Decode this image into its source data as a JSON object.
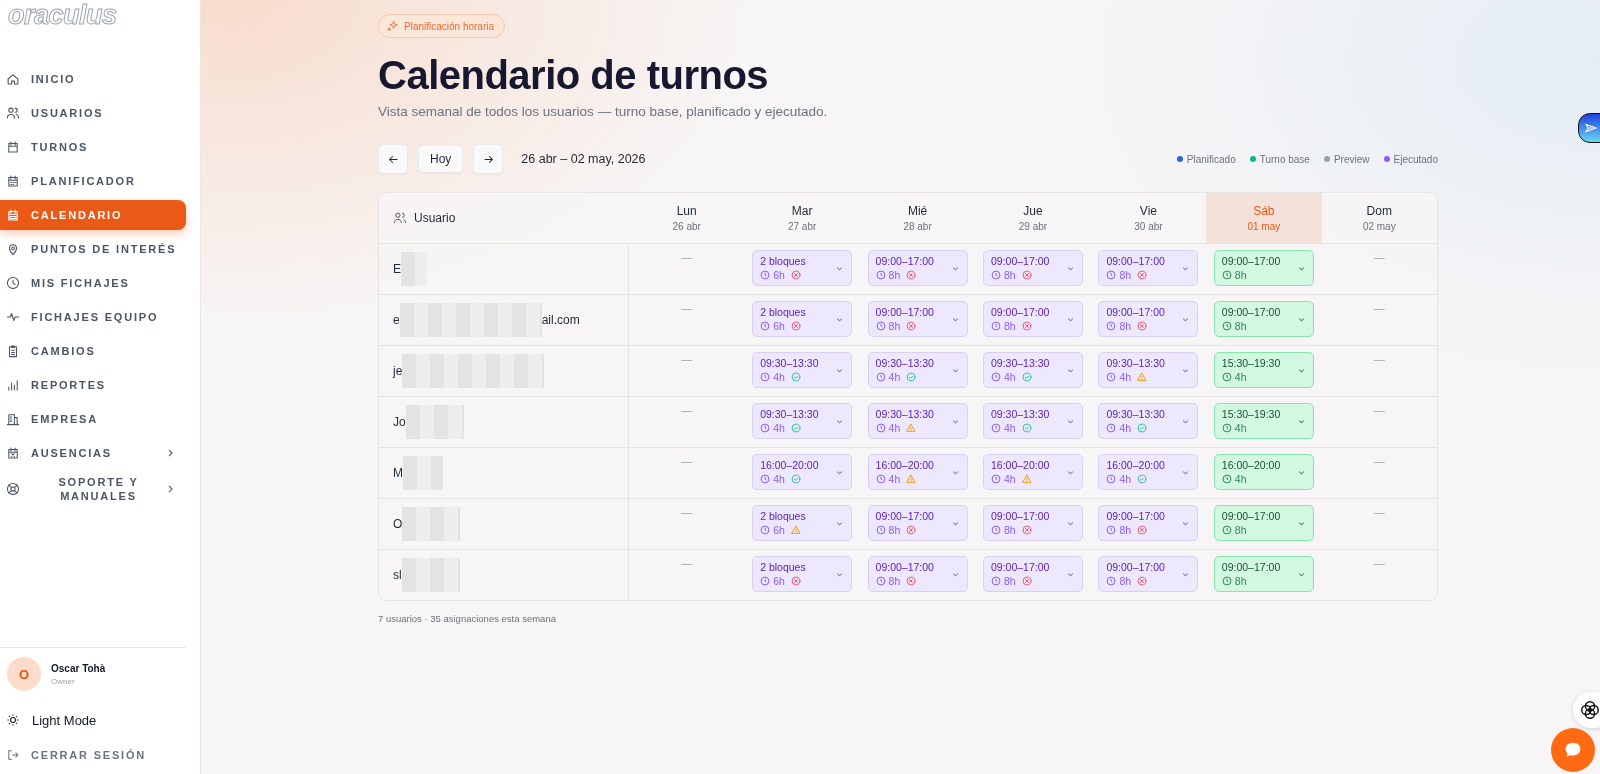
{
  "sidebar": {
    "logo": "oraculus",
    "items": [
      {
        "label": "INICIO",
        "selected": false,
        "submenu": false
      },
      {
        "label": "USUARIOS",
        "selected": false,
        "submenu": false
      },
      {
        "label": "TURNOS",
        "selected": false,
        "submenu": false
      },
      {
        "label": "PLANIFICADOR",
        "selected": false,
        "submenu": false
      },
      {
        "label": "CALENDARIO",
        "selected": true,
        "submenu": false
      },
      {
        "label": "PUNTOS DE INTERÉS",
        "selected": false,
        "submenu": false
      },
      {
        "label": "MIS FICHAJES",
        "selected": false,
        "submenu": false
      },
      {
        "label": "FICHAJES EQUIPO",
        "selected": false,
        "submenu": false
      },
      {
        "label": "CAMBIOS",
        "selected": false,
        "submenu": false
      },
      {
        "label": "REPORTES",
        "selected": false,
        "submenu": false
      },
      {
        "label": "EMPRESA",
        "selected": false,
        "submenu": false
      },
      {
        "label": "AUSENCIAS",
        "selected": false,
        "submenu": true
      },
      {
        "label": "SOPORTE Y MANUALES",
        "selected": false,
        "submenu": true
      }
    ],
    "user": {
      "initial": "O",
      "name": "Oscar Tohà",
      "role": "Owner"
    },
    "theme": "Light Mode",
    "logout": "CERRAR SESIÓN"
  },
  "header": {
    "badge": "Planificación horaria",
    "title": "Calendario de turnos",
    "subtitle": "Vista semanal de todos los usuarios — turno base, planificado y ejecutado."
  },
  "toolbar": {
    "today": "Hoy",
    "range": "26 abr – 02 may, 2026"
  },
  "legend": [
    {
      "label": "Planificado",
      "color": "#2563eb"
    },
    {
      "label": "Turno base",
      "color": "#10b981"
    },
    {
      "label": "Preview",
      "color": "#94a3b8"
    },
    {
      "label": "Ejecutado",
      "color": "#8b5cf6"
    }
  ],
  "table": {
    "user_column": "Usuario",
    "days": [
      {
        "name": "Lun",
        "date": "26 abr",
        "selected": false
      },
      {
        "name": "Mar",
        "date": "27 abr",
        "selected": false
      },
      {
        "name": "Mié",
        "date": "28 abr",
        "selected": false
      },
      {
        "name": "Jue",
        "date": "29 abr",
        "selected": false
      },
      {
        "name": "Vie",
        "date": "30 abr",
        "selected": false
      },
      {
        "name": "Sáb",
        "date": "01 may",
        "selected": true
      },
      {
        "name": "Dom",
        "date": "02 may",
        "selected": false
      }
    ],
    "rows": [
      {
        "user": "E",
        "redacted": true,
        "cells": [
          {
            "kind": "empty",
            "text": "—"
          },
          {
            "kind": "planned",
            "time": "2 bloques",
            "hours": "6h",
            "status": {
              "kind": "error"
            }
          },
          {
            "kind": "planned",
            "time": "09:00–17:00",
            "hours": "8h",
            "status": {
              "kind": "error"
            }
          },
          {
            "kind": "planned",
            "time": "09:00–17:00",
            "hours": "8h",
            "status": {
              "kind": "error"
            }
          },
          {
            "kind": "planned",
            "time": "09:00–17:00",
            "hours": "8h",
            "status": {
              "kind": "error"
            }
          },
          {
            "kind": "base",
            "time": "09:00–17:00",
            "hours": "8h"
          },
          {
            "kind": "empty",
            "text": "—"
          }
        ]
      },
      {
        "user": "e",
        "user_end": "ail.com",
        "redacted": true,
        "cells": [
          {
            "kind": "empty",
            "text": "—"
          },
          {
            "kind": "planned",
            "time": "2 bloques",
            "hours": "6h",
            "status": {
              "kind": "error"
            }
          },
          {
            "kind": "planned",
            "time": "09:00–17:00",
            "hours": "8h",
            "status": {
              "kind": "error"
            }
          },
          {
            "kind": "planned",
            "time": "09:00–17:00",
            "hours": "8h",
            "status": {
              "kind": "error"
            }
          },
          {
            "kind": "planned",
            "time": "09:00–17:00",
            "hours": "8h",
            "status": {
              "kind": "error"
            }
          },
          {
            "kind": "base",
            "time": "09:00–17:00",
            "hours": "8h"
          },
          {
            "kind": "empty",
            "text": "—"
          }
        ]
      },
      {
        "user": "je",
        "redacted": true,
        "cells": [
          {
            "kind": "empty",
            "text": "—"
          },
          {
            "kind": "planned",
            "time": "09:30–13:30",
            "hours": "4h",
            "status": {
              "kind": "ok"
            }
          },
          {
            "kind": "planned",
            "time": "09:30–13:30",
            "hours": "4h",
            "status": {
              "kind": "ok"
            }
          },
          {
            "kind": "planned",
            "time": "09:30–13:30",
            "hours": "4h",
            "status": {
              "kind": "ok"
            }
          },
          {
            "kind": "planned",
            "time": "09:30–13:30",
            "hours": "4h",
            "status": {
              "kind": "warning"
            }
          },
          {
            "kind": "base",
            "time": "15:30–19:30",
            "hours": "4h"
          },
          {
            "kind": "empty",
            "text": "—"
          }
        ]
      },
      {
        "user": "Jo",
        "redacted": true,
        "cells": [
          {
            "kind": "empty",
            "text": "—"
          },
          {
            "kind": "planned",
            "time": "09:30–13:30",
            "hours": "4h",
            "status": {
              "kind": "ok"
            }
          },
          {
            "kind": "planned",
            "time": "09:30–13:30",
            "hours": "4h",
            "status": {
              "kind": "warning"
            }
          },
          {
            "kind": "planned",
            "time": "09:30–13:30",
            "hours": "4h",
            "status": {
              "kind": "ok"
            }
          },
          {
            "kind": "planned",
            "time": "09:30–13:30",
            "hours": "4h",
            "status": {
              "kind": "ok"
            }
          },
          {
            "kind": "base",
            "time": "15:30–19:30",
            "hours": "4h"
          },
          {
            "kind": "empty",
            "text": "—"
          }
        ]
      },
      {
        "user": "M",
        "redacted": true,
        "cells": [
          {
            "kind": "empty",
            "text": "—"
          },
          {
            "kind": "planned",
            "time": "16:00–20:00",
            "hours": "4h",
            "status": {
              "kind": "ok"
            }
          },
          {
            "kind": "planned",
            "time": "16:00–20:00",
            "hours": "4h",
            "status": {
              "kind": "warning"
            }
          },
          {
            "kind": "planned",
            "time": "16:00–20:00",
            "hours": "4h",
            "status": {
              "kind": "warning"
            }
          },
          {
            "kind": "planned",
            "time": "16:00–20:00",
            "hours": "4h",
            "status": {
              "kind": "ok"
            }
          },
          {
            "kind": "base",
            "time": "16:00–20:00",
            "hours": "4h"
          },
          {
            "kind": "empty",
            "text": "—"
          }
        ]
      },
      {
        "user": "O",
        "redacted": true,
        "cells": [
          {
            "kind": "empty",
            "text": "—"
          },
          {
            "kind": "planned",
            "time": "2 bloques",
            "hours": "6h",
            "status": {
              "kind": "warning"
            }
          },
          {
            "kind": "planned",
            "time": "09:00–17:00",
            "hours": "8h",
            "status": {
              "kind": "error"
            }
          },
          {
            "kind": "planned",
            "time": "09:00–17:00",
            "hours": "8h",
            "status": {
              "kind": "error"
            }
          },
          {
            "kind": "planned",
            "time": "09:00–17:00",
            "hours": "8h",
            "status": {
              "kind": "error"
            }
          },
          {
            "kind": "base",
            "time": "09:00–17:00",
            "hours": "8h"
          },
          {
            "kind": "empty",
            "text": "—"
          }
        ]
      },
      {
        "user": "sl",
        "redacted": true,
        "cells": [
          {
            "kind": "empty",
            "text": "—"
          },
          {
            "kind": "planned",
            "time": "2 bloques",
            "hours": "6h",
            "status": {
              "kind": "error"
            }
          },
          {
            "kind": "planned",
            "time": "09:00–17:00",
            "hours": "8h",
            "status": {
              "kind": "error"
            }
          },
          {
            "kind": "planned",
            "time": "09:00–17:00",
            "hours": "8h",
            "status": {
              "kind": "error"
            }
          },
          {
            "kind": "planned",
            "time": "09:00–17:00",
            "hours": "8h",
            "status": {
              "kind": "error"
            }
          },
          {
            "kind": "base",
            "time": "09:00–17:00",
            "hours": "8h"
          },
          {
            "kind": "empty",
            "text": "—"
          }
        ]
      }
    ]
  },
  "footer": "7 usuarios · 35 asignaciones esta semana"
}
